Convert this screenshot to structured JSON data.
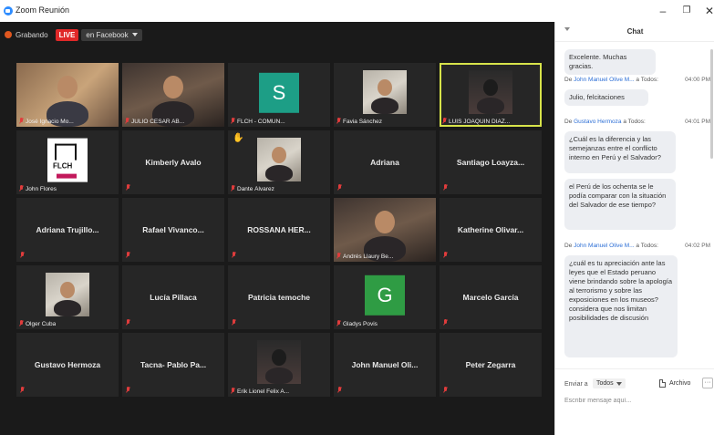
{
  "window": {
    "title": "Zoom Reunión"
  },
  "recording": {
    "label": "Grabando",
    "live_badge": "LIVE",
    "live_target": "en Facebook"
  },
  "participants": [
    {
      "name": "José Ignacio Mo...",
      "video": "warm",
      "caption": true
    },
    {
      "name": "JULIO CESAR AB...",
      "video": "office",
      "caption": true
    },
    {
      "name": "FLCH - COMUN...",
      "avatar_letter": "S",
      "caption": true
    },
    {
      "name": "Favia Sánchez",
      "video": "room",
      "caption": true
    },
    {
      "name": "LUIS JOAQUIN DIAZ...",
      "video": "dark",
      "caption": true,
      "active": true
    },
    {
      "name": "John Flores",
      "logo": "FLCH",
      "caption": true
    },
    {
      "name": "Kimberly Avalo"
    },
    {
      "name": "Dante Álvarez",
      "video": "room",
      "caption": true,
      "raised_hand": true
    },
    {
      "name": "Adriana"
    },
    {
      "name": "Santiago Loayza..."
    },
    {
      "name": "Adriana Trujillo..."
    },
    {
      "name": "Rafael Vivanco..."
    },
    {
      "name": "ROSSANA HER..."
    },
    {
      "name": "Andrés Llaury Be...",
      "video": "office",
      "caption": true
    },
    {
      "name": "Katherine Olivar..."
    },
    {
      "name": "Olger Cuba",
      "video": "room",
      "caption": true
    },
    {
      "name": "Lucía Pillaca"
    },
    {
      "name": "Patricia temoche"
    },
    {
      "name": "Gladys Povis",
      "avatar_letter": "G",
      "caption": true
    },
    {
      "name": "Marcelo García"
    },
    {
      "name": "Gustavo Hermoza"
    },
    {
      "name": "Tacna- Pablo Pa..."
    },
    {
      "name": "Erik Lionel Felix A...",
      "video": "dark",
      "caption": true
    },
    {
      "name": "John Manuel Oli..."
    },
    {
      "name": "Peter Zegarra"
    }
  ],
  "chat": {
    "title": "Chat",
    "messages": [
      {
        "text": "Excelente. Muchas gracias."
      },
      {
        "from": "De",
        "sender": "John Manuel Olive M...",
        "to": "a Todos:",
        "time": "04:00 PM"
      },
      {
        "text": "Julio, felcitaciones"
      },
      {
        "from": "De",
        "sender": "Gustavo Hermoza",
        "to": "a Todos:",
        "time": "04:01 PM"
      },
      {
        "text": "¿Cuál es la diferencia y las semejanzas entre el conflicto interno en Perú y el Salvador?"
      },
      {
        "text": "el Perú de los ochenta se le podía comparar con la situación del Salvador de ese tiempo?"
      },
      {
        "from": "De",
        "sender": "John Manuel Olive M...",
        "to": "a Todos:",
        "time": "04:02 PM"
      },
      {
        "text": "¿cuál es tu apreciación ante las leyes que el Estado peruano viene brindando sobre la apología al terrorismo y sobre las exposiciones en los museos? considera que nos limitan posibilidades de discusión"
      }
    ],
    "send_to_label": "Enviar a",
    "send_to_value": "Todos",
    "file_label": "Archivo",
    "more_label": "···",
    "input_placeholder": "Escribir mensaje aquí..."
  }
}
